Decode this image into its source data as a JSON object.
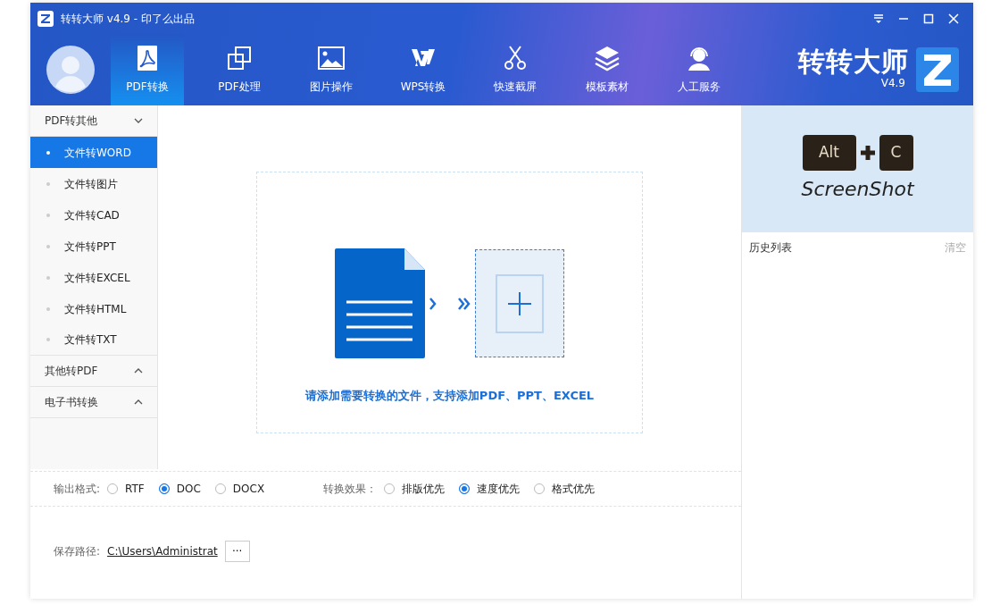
{
  "window": {
    "title": "转转大师 v4.9 - 印了么出品"
  },
  "toolbar": {
    "tabs": [
      {
        "label": "PDF转换",
        "kind": "pdf",
        "selected": true
      },
      {
        "label": "PDF处理",
        "kind": "pages",
        "selected": false
      },
      {
        "label": "图片操作",
        "kind": "image",
        "selected": false
      },
      {
        "label": "WPS转换",
        "kind": "wps",
        "selected": false
      },
      {
        "label": "快速截屏",
        "kind": "scissors",
        "selected": false
      },
      {
        "label": "模板素材",
        "kind": "layers",
        "selected": false
      },
      {
        "label": "人工服务",
        "kind": "headset",
        "selected": false
      }
    ]
  },
  "brand": {
    "name": "转转大师",
    "version": "V4.9"
  },
  "sidebar": {
    "groups": [
      {
        "label": "PDF转其他",
        "expanded": true,
        "items": [
          {
            "label": "文件转WORD",
            "selected": true
          },
          {
            "label": "文件转图片",
            "selected": false
          },
          {
            "label": "文件转CAD",
            "selected": false
          },
          {
            "label": "文件转PPT",
            "selected": false
          },
          {
            "label": "文件转EXCEL",
            "selected": false
          },
          {
            "label": "文件转HTML",
            "selected": false
          },
          {
            "label": "文件转TXT",
            "selected": false
          }
        ]
      },
      {
        "label": "其他转PDF",
        "expanded": false
      },
      {
        "label": "电子书转换",
        "expanded": false
      }
    ]
  },
  "drop_zone": {
    "hint": "请添加需要转换的文件，支持添加PDF、PPT、EXCEL"
  },
  "banner": {
    "keys": [
      "Alt",
      "C"
    ],
    "caption": "ScreenShot"
  },
  "history": {
    "title": "历史列表",
    "clear": "清空"
  },
  "options": [
    {
      "label": "输出格式:",
      "choices": [
        {
          "label": "RTF",
          "selected": false
        },
        {
          "label": "DOC",
          "selected": true
        },
        {
          "label": "DOCX",
          "selected": false
        }
      ]
    },
    {
      "label": "转换效果：",
      "choices": [
        {
          "label": "排版优先",
          "selected": false
        },
        {
          "label": "速度优先",
          "selected": true
        },
        {
          "label": "格式优先",
          "selected": false
        }
      ]
    }
  ],
  "save_path": {
    "label": "保存路径:",
    "path": "C:\\Users\\Administrat",
    "browse": "···"
  }
}
